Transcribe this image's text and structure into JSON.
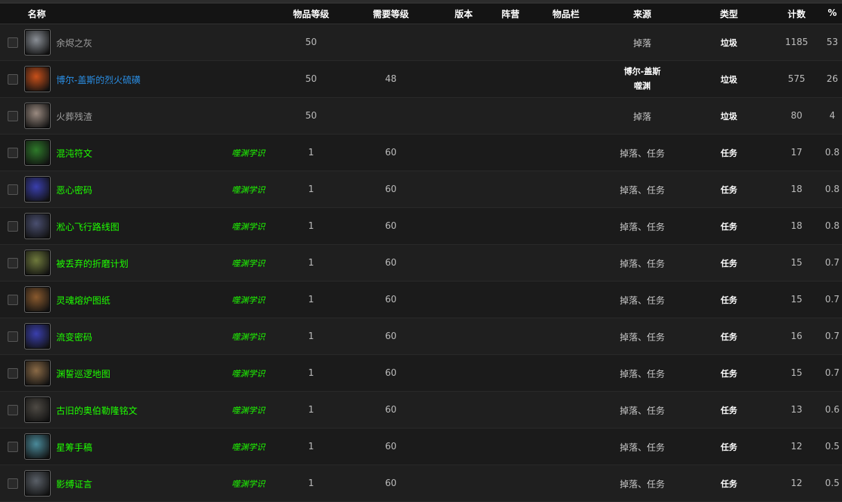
{
  "columns": {
    "name": "名称",
    "item_level": "物品等级",
    "req_level": "需要等级",
    "version": "版本",
    "faction": "阵营",
    "slot": "物品栏",
    "source": "来源",
    "type": "类型",
    "count": "计数",
    "pct": "%"
  },
  "rows": [
    {
      "name": "余烬之灰",
      "quality": "gray",
      "icon": "ash-icon",
      "icon_color": "#8a8f96",
      "tag": "",
      "ilvl": "50",
      "req": "",
      "source": "掉落",
      "source2": "",
      "type": "垃圾",
      "count": "1185",
      "pct": "53"
    },
    {
      "name": "博尔-盖斯的烈火硫磺",
      "quality": "blue",
      "icon": "fire-sulfur-icon",
      "icon_color": "#c8501a",
      "tag": "",
      "ilvl": "50",
      "req": "48",
      "source": "博尔-盖斯",
      "source2": "噬渊",
      "type": "垃圾",
      "count": "575",
      "pct": "26"
    },
    {
      "name": "火葬残渣",
      "quality": "gray",
      "icon": "cremation-remains-icon",
      "icon_color": "#9a8a80",
      "tag": "",
      "ilvl": "50",
      "req": "",
      "source": "掉落",
      "source2": "",
      "type": "垃圾",
      "count": "80",
      "pct": "4"
    },
    {
      "name": "混沌符文",
      "quality": "green",
      "icon": "chaos-rune-icon",
      "icon_color": "#2e7a2a",
      "tag": "噬渊学识",
      "ilvl": "1",
      "req": "60",
      "source": "掉落、任务",
      "source2": "",
      "type": "任务",
      "count": "17",
      "pct": "0.8"
    },
    {
      "name": "恶心密码",
      "quality": "green",
      "icon": "cipher-cube-icon",
      "icon_color": "#3a3fae",
      "tag": "噬渊学识",
      "ilvl": "1",
      "req": "60",
      "source": "掉落、任务",
      "source2": "",
      "type": "任务",
      "count": "18",
      "pct": "0.8"
    },
    {
      "name": "淞心飞行路线图",
      "quality": "green",
      "icon": "flight-map-icon",
      "icon_color": "#4a4f70",
      "tag": "噬渊学识",
      "ilvl": "1",
      "req": "60",
      "source": "掉落、任务",
      "source2": "",
      "type": "任务",
      "count": "18",
      "pct": "0.8"
    },
    {
      "name": "被丢弃的折磨计划",
      "quality": "green",
      "icon": "torment-plan-icon",
      "icon_color": "#6f7a3c",
      "tag": "噬渊学识",
      "ilvl": "1",
      "req": "60",
      "source": "掉落、任务",
      "source2": "",
      "type": "任务",
      "count": "15",
      "pct": "0.7"
    },
    {
      "name": "灵魂熔炉图纸",
      "quality": "green",
      "icon": "scroll-icon",
      "icon_color": "#8a5a2e",
      "tag": "噬渊学识",
      "ilvl": "1",
      "req": "60",
      "source": "掉落、任务",
      "source2": "",
      "type": "任务",
      "count": "15",
      "pct": "0.7"
    },
    {
      "name": "流变密码",
      "quality": "green",
      "icon": "cipher-cube-icon",
      "icon_color": "#3a3fae",
      "tag": "噬渊学识",
      "ilvl": "1",
      "req": "60",
      "source": "掉落、任务",
      "source2": "",
      "type": "任务",
      "count": "16",
      "pct": "0.7"
    },
    {
      "name": "渊誓巡逻地图",
      "quality": "green",
      "icon": "patrol-map-icon",
      "icon_color": "#8a6a46",
      "tag": "噬渊学识",
      "ilvl": "1",
      "req": "60",
      "source": "掉落、任务",
      "source2": "",
      "type": "任务",
      "count": "15",
      "pct": "0.7"
    },
    {
      "name": "古旧的奥伯勒隆铭文",
      "quality": "green",
      "icon": "inscription-tablet-icon",
      "icon_color": "#4e4a44",
      "tag": "噬渊学识",
      "ilvl": "1",
      "req": "60",
      "source": "掉落、任务",
      "source2": "",
      "type": "任务",
      "count": "13",
      "pct": "0.6"
    },
    {
      "name": "星筹手稿",
      "quality": "green",
      "icon": "manuscript-icon",
      "icon_color": "#4a8a9a",
      "tag": "噬渊学识",
      "ilvl": "1",
      "req": "60",
      "source": "掉落、任务",
      "source2": "",
      "type": "任务",
      "count": "12",
      "pct": "0.5"
    },
    {
      "name": "影缚证言",
      "quality": "green",
      "icon": "testimony-orb-icon",
      "icon_color": "#5a6068",
      "tag": "噬渊学识",
      "ilvl": "1",
      "req": "60",
      "source": "掉落、任务",
      "source2": "",
      "type": "任务",
      "count": "12",
      "pct": "0.5"
    }
  ]
}
